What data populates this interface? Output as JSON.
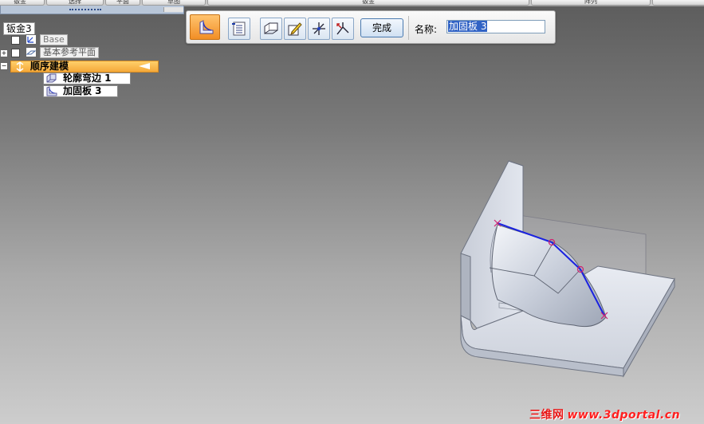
{
  "top_tabs": [
    "钣金",
    "选择",
    "平面",
    "草图",
    "钣金",
    "阵列"
  ],
  "tree": {
    "root": "钣金3",
    "base_feature": "Base",
    "ref_planes": "基本参考平面",
    "sequence_group": "顺序建模",
    "features": [
      "轮廓弯边 1",
      "加固板 3"
    ]
  },
  "command_bar": {
    "finish_label": "完成",
    "name_label": "名称:",
    "name_value": "加固板 3"
  },
  "watermark": {
    "cn": "三维网",
    "url": "www.3dportal.cn"
  },
  "colors": {
    "accent_orange": "#f5a93a",
    "profile_blue": "#1a22e0",
    "watermark_red": "#e81616"
  }
}
